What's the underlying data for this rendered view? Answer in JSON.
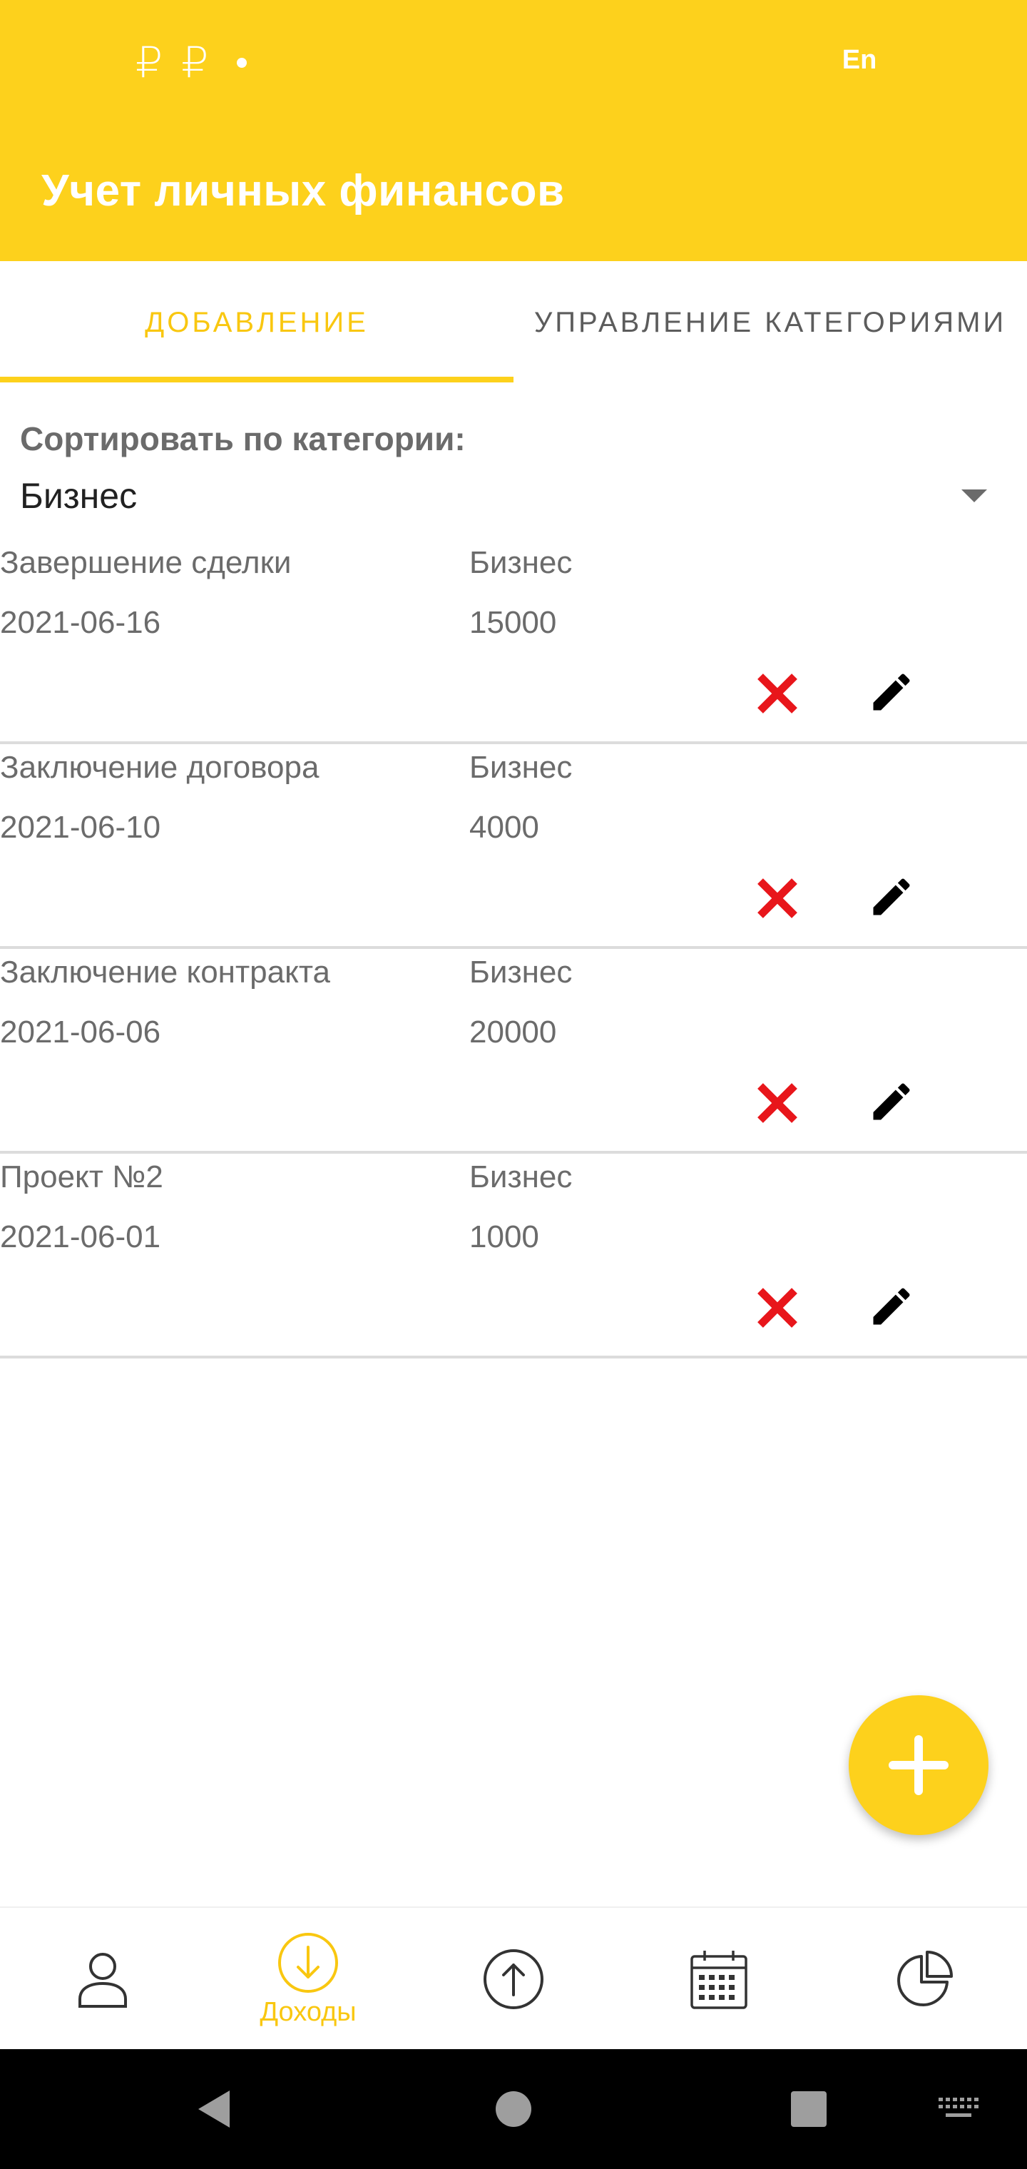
{
  "status_bar": {
    "left_icons": [
      "₽",
      "₽"
    ],
    "lang": "En"
  },
  "app": {
    "title": "Учет личных финансов"
  },
  "tabs": [
    {
      "label": "ДОБАВЛЕНИЕ",
      "active": true
    },
    {
      "label": "УПРАВЛЕНИЕ КАТЕГОРИЯМИ",
      "active": false
    }
  ],
  "sort": {
    "label": "Сортировать по категории:",
    "value": "Бизнес"
  },
  "entries": [
    {
      "name": "Завершение сделки",
      "category": "Бизнес",
      "date": "2021-06-16",
      "amount": "15000"
    },
    {
      "name": "Заключение договора",
      "category": "Бизнес",
      "date": "2021-06-10",
      "amount": "4000"
    },
    {
      "name": "Заключение контракта",
      "category": "Бизнес",
      "date": "2021-06-06",
      "amount": "20000"
    },
    {
      "name": "Проект №2",
      "category": "Бизнес",
      "date": "2021-06-01",
      "amount": "1000"
    }
  ],
  "bottom_nav": [
    {
      "icon": "person-icon",
      "label": "",
      "active": false
    },
    {
      "icon": "income-icon",
      "label": "Доходы",
      "active": true
    },
    {
      "icon": "expense-icon",
      "label": "",
      "active": false
    },
    {
      "icon": "calendar-icon",
      "label": "",
      "active": false
    },
    {
      "icon": "pie-chart-icon",
      "label": "",
      "active": false
    }
  ],
  "colors": {
    "accent": "#FDD11C",
    "accent_text": "#F9C710",
    "delete": "#E8161B",
    "text_secondary": "#6b6b6b"
  }
}
